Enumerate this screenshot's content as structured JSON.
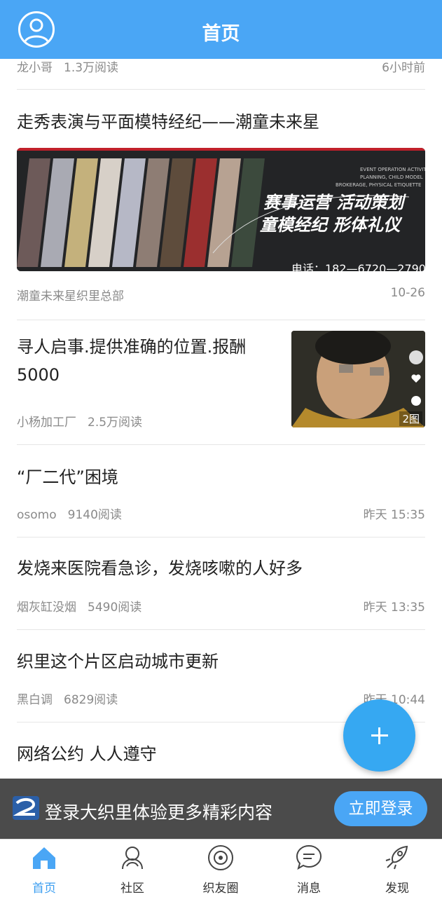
{
  "header": {
    "title": "首页",
    "avatar_icon": "user-circle-icon"
  },
  "articles": [
    {
      "author": "龙小哥",
      "reads": "1.3万阅读",
      "time": "6小时前"
    },
    {
      "title": "走秀表演与平面模特经纪——潮童未来星",
      "author": "潮童未来星织里总部",
      "time": "10-26",
      "banner": {
        "line1": "赛事运营  活动策划",
        "line2": "童模经纪  形体礼仪",
        "en1": "EVENT OPERATION ACTIVITY",
        "en2": "PLANNING, CHILD MODEL",
        "en3": "BROKERAGE, PHYSICAL ETIQUETTE",
        "phone": "电话：182—6720—2790"
      }
    },
    {
      "title_line1": "寻人启事.提供准确的位置.报酬",
      "title_line2": "5000",
      "author": "小杨加工厂",
      "reads": "2.5万阅读",
      "thumb_badge": "2图"
    },
    {
      "title": "“厂二代”困境",
      "author": "osomo",
      "reads": "9140阅读",
      "time": "昨天 15:35"
    },
    {
      "title": "发烧来医院看急诊，发烧咳嗽的人好多",
      "author": "烟灰缸没烟",
      "reads": "5490阅读",
      "time": "昨天 13:35"
    },
    {
      "title": "织里这个片区启动城市更新",
      "author": "黑白调",
      "reads": "6829阅读",
      "time": "昨天 10:44"
    },
    {
      "title": "网络公约 人人遵守"
    }
  ],
  "fab": {
    "icon": "plus-icon"
  },
  "login_bar": {
    "text": "登录大织里体验更多精彩内容",
    "button": "立即登录"
  },
  "tabs": [
    {
      "label": "首页",
      "icon": "home-icon",
      "active": true
    },
    {
      "label": "社区",
      "icon": "community-icon"
    },
    {
      "label": "织友圈",
      "icon": "circle-icon"
    },
    {
      "label": "消息",
      "icon": "message-icon"
    },
    {
      "label": "发现",
      "icon": "rocket-icon"
    }
  ],
  "colors": {
    "brand": "#4aa6f5",
    "fab": "#36a8f2",
    "active_tab": "#3c9ef0"
  }
}
